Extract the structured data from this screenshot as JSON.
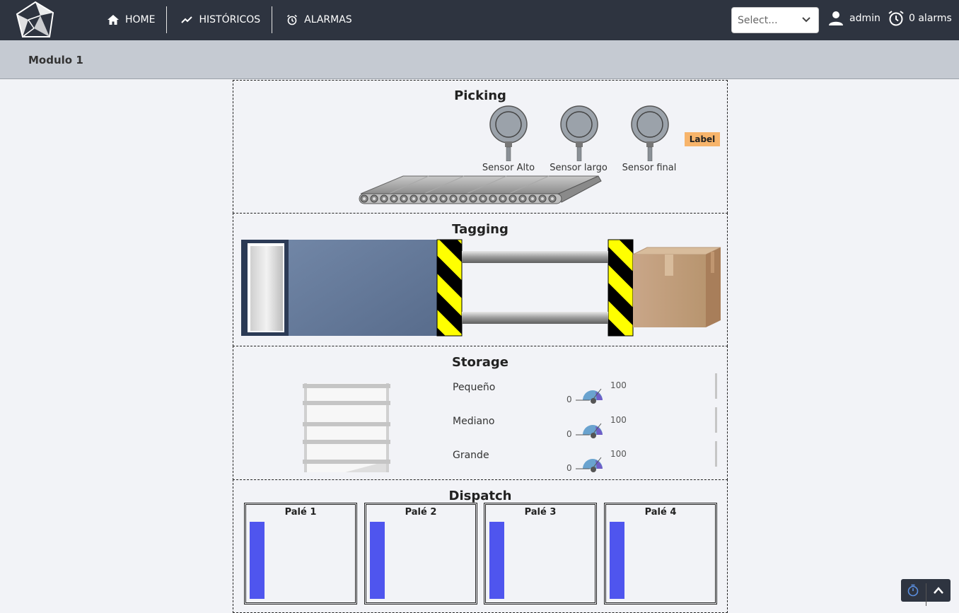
{
  "nav": {
    "home": "HOME",
    "historicos": "HISTÓRICOS",
    "alarmas": "ALARMAS"
  },
  "header": {
    "select_placeholder": "Select...",
    "user": "admin",
    "alarms": "0 alarms"
  },
  "page_title": "Modulo 1",
  "picking": {
    "title": "Picking",
    "sensors": [
      "Sensor Alto",
      "Sensor largo",
      "Sensor final"
    ],
    "badge": "Label"
  },
  "tagging": {
    "title": "Tagging"
  },
  "storage": {
    "title": "Storage",
    "items": [
      {
        "label": "Pequeño",
        "min": "0",
        "max": "100"
      },
      {
        "label": "Mediano",
        "min": "0",
        "max": "100"
      },
      {
        "label": "Grande",
        "min": "0",
        "max": "100"
      }
    ]
  },
  "dispatch": {
    "title": "Dispatch",
    "pales": [
      "Palé 1",
      "Palé 2",
      "Palé 3",
      "Palé 4"
    ]
  },
  "colors": {
    "topbar": "#2e3440",
    "subheader": "#c5cad2",
    "badge": "#f7b46b",
    "pale_bar": "#4f55ee",
    "hazard_yellow": "#ffff00"
  },
  "icons": [
    "logo-icon",
    "home-icon",
    "chart-line-icon",
    "alarm-clock-icon",
    "chevron-down-icon",
    "user-icon",
    "timer-icon",
    "chevron-up-icon"
  ]
}
